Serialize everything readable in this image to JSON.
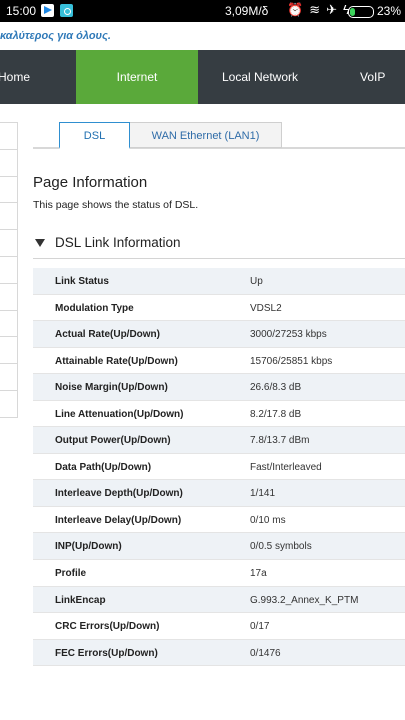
{
  "status_bar": {
    "time": "15:00",
    "net_speed": "3,09M/δ",
    "icons": [
      "alarm-off-icon",
      "wifi-icon",
      "airplane-icon",
      "charging-icon"
    ],
    "battery_percent": "23%",
    "battery_level": 0.23,
    "battery_color": "#3cd35c"
  },
  "banner": {
    "tagline": "καλύτερος για όλους."
  },
  "nav": {
    "items": [
      {
        "label": "Home"
      },
      {
        "label": "Internet"
      },
      {
        "label": "Local Network"
      },
      {
        "label": "VoIP"
      }
    ],
    "active": "Internet",
    "active_color": "#5aa93a",
    "bar_color": "#363d42"
  },
  "tabs": [
    {
      "label": "DSL"
    },
    {
      "label": "WAN Ethernet (LAN1)"
    }
  ],
  "page": {
    "title": "Page Information",
    "description": "This page shows the status of DSL."
  },
  "section": {
    "title": "DSL Link Information"
  },
  "rows": [
    {
      "label": "Link Status",
      "value": "Up"
    },
    {
      "label": "Modulation Type",
      "value": "VDSL2"
    },
    {
      "label": "Actual Rate(Up/Down)",
      "value": "3000/27253 kbps"
    },
    {
      "label": "Attainable Rate(Up/Down)",
      "value": "15706/25851 kbps"
    },
    {
      "label": "Noise Margin(Up/Down)",
      "value": "26.6/8.3 dB"
    },
    {
      "label": "Line Attenuation(Up/Down)",
      "value": "8.2/17.8 dB"
    },
    {
      "label": "Output Power(Up/Down)",
      "value": "7.8/13.7 dBm"
    },
    {
      "label": "Data Path(Up/Down)",
      "value": "Fast/Interleaved"
    },
    {
      "label": "Interleave Depth(Up/Down)",
      "value": "1/141"
    },
    {
      "label": "Interleave Delay(Up/Down)",
      "value": "0/10 ms"
    },
    {
      "label": "INP(Up/Down)",
      "value": "0/0.5 symbols"
    },
    {
      "label": "Profile",
      "value": "17a"
    },
    {
      "label": "LinkEncap",
      "value": "G.993.2_Annex_K_PTM"
    },
    {
      "label": "CRC Errors(Up/Down)",
      "value": "0/17"
    },
    {
      "label": "FEC Errors(Up/Down)",
      "value": "0/1476"
    }
  ]
}
